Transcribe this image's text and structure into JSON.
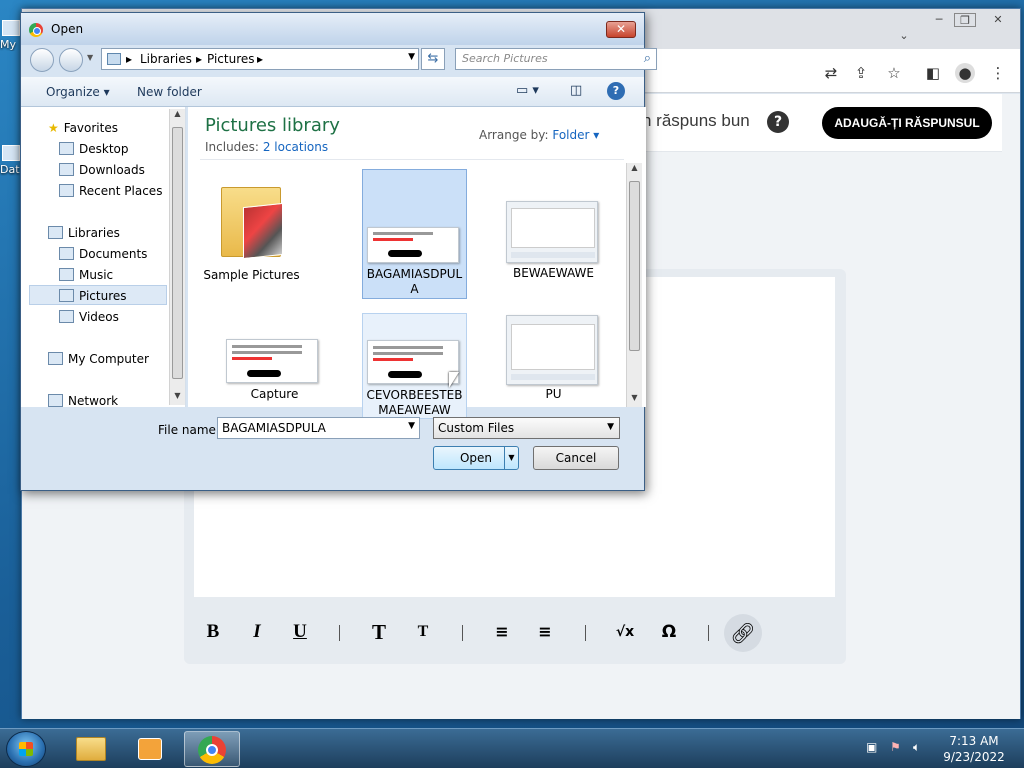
{
  "desktop": {
    "icons": [
      {
        "label": "My"
      },
      {
        "label": "Dat"
      }
    ]
  },
  "browser": {
    "page": {
      "answer_prompt": "n răspuns bun",
      "help_symbol": "?",
      "add_answer_button": "ADAUGĂ-ȚI RĂSPUNSUL"
    },
    "toolbar_buttons": [
      "B",
      "I",
      "U",
      "T",
      "T",
      "≡",
      "≡",
      "√x",
      "Ω"
    ]
  },
  "dialog": {
    "title": "Open",
    "breadcrumb": [
      "Libraries",
      "Pictures"
    ],
    "search_placeholder": "Search Pictures",
    "commands": {
      "organize": "Organize ▾",
      "new_folder": "New folder"
    },
    "nav": {
      "favorites": "Favorites",
      "desktop": "Desktop",
      "downloads": "Downloads",
      "recent_places": "Recent Places",
      "libraries": "Libraries",
      "documents": "Documents",
      "music": "Music",
      "pictures": "Pictures",
      "videos": "Videos",
      "my_computer": "My Computer",
      "network": "Network"
    },
    "library": {
      "title": "Pictures library",
      "includes_label": "Includes:",
      "includes_link": "2 locations",
      "arrange_label": "Arrange by:",
      "arrange_value": "Folder ▾"
    },
    "items": [
      {
        "name": "Sample Pictures",
        "kind": "folder"
      },
      {
        "name": "BAGAMIASDPULA",
        "kind": "screenshot",
        "selected": true
      },
      {
        "name": "BEWAEWAWE",
        "kind": "screenshot"
      },
      {
        "name": "Capture",
        "kind": "screenshot"
      },
      {
        "name": "CEVORBEESTEBMAEAWEAW",
        "kind": "screenshot",
        "hover": true
      },
      {
        "name": "PU",
        "kind": "screenshot"
      }
    ],
    "file_name_label": "File name:",
    "file_name_value": "BAGAMIASDPULA",
    "file_type": "Custom Files",
    "open_button": "Open",
    "cancel_button": "Cancel"
  },
  "taskbar": {
    "time": "7:13 AM",
    "date": "9/23/2022"
  }
}
